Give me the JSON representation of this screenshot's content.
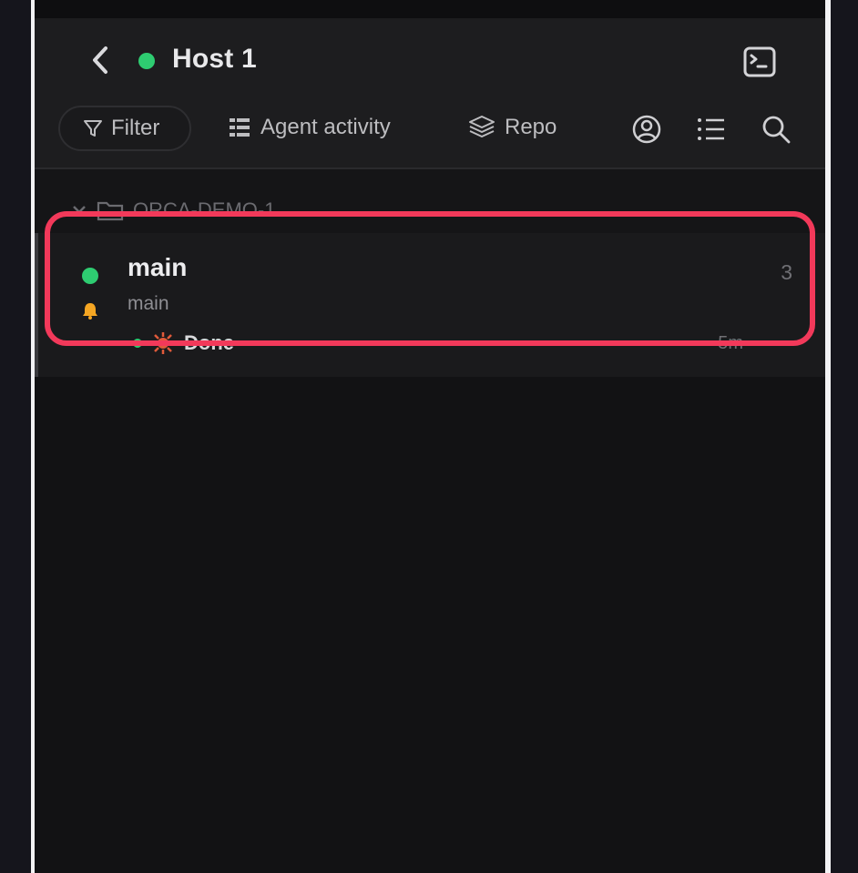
{
  "header": {
    "title": "Host 1",
    "status_color": "#2ecc71"
  },
  "toolbar": {
    "filter_label": "Filter",
    "activity_label": "Agent activity",
    "repo_label": "Repo"
  },
  "group": {
    "label": "ORCA-DEMO-1"
  },
  "item": {
    "title": "main",
    "subtitle": "main",
    "count": "3",
    "activity": {
      "label": "Done",
      "time": "5m"
    }
  },
  "colors": {
    "accent_highlight": "#f2395a",
    "status_green": "#2ecc71",
    "bell_yellow": "#f5a623"
  }
}
